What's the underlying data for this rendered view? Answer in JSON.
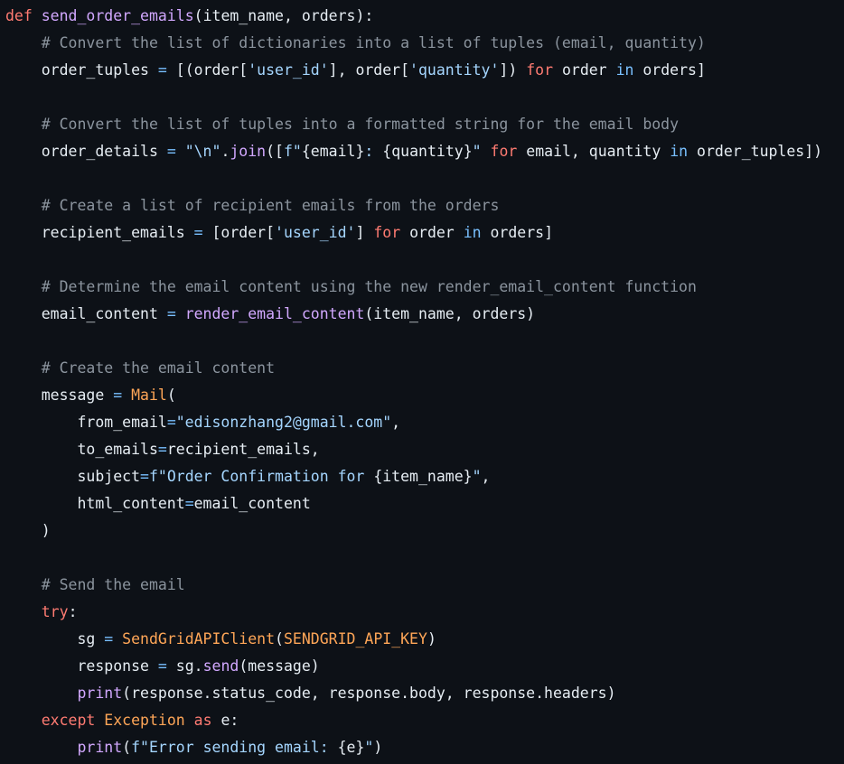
{
  "editor": {
    "theme_colors": {
      "background": "#0d1117",
      "plain": "#e6edf3",
      "keyword": "#ff7b72",
      "function": "#d2a8ff",
      "string": "#a5d6ff",
      "comment": "#8b949e",
      "builtin": "#79c0ff",
      "class": "#ffa657"
    },
    "lines": [
      [
        [
          "keyword",
          "def"
        ],
        [
          "plain",
          " "
        ],
        [
          "func",
          "send_order_emails"
        ],
        [
          "plain",
          "(item_name, orders):"
        ]
      ],
      [
        [
          "plain",
          "    "
        ],
        [
          "comment",
          "# Convert the list of dictionaries into a list of tuples (email, quantity)"
        ]
      ],
      [
        [
          "plain",
          "    order_tuples "
        ],
        [
          "op",
          "="
        ],
        [
          "plain",
          " [(order["
        ],
        [
          "string",
          "'user_id'"
        ],
        [
          "plain",
          "], order["
        ],
        [
          "string",
          "'quantity'"
        ],
        [
          "plain",
          "]) "
        ],
        [
          "keyword",
          "for"
        ],
        [
          "plain",
          " order "
        ],
        [
          "op",
          "in"
        ],
        [
          "plain",
          " orders]"
        ]
      ],
      [],
      [
        [
          "plain",
          "    "
        ],
        [
          "comment",
          "# Convert the list of tuples into a formatted string for the email body"
        ]
      ],
      [
        [
          "plain",
          "    order_details "
        ],
        [
          "op",
          "="
        ],
        [
          "plain",
          " "
        ],
        [
          "string",
          "\"\\n\""
        ],
        [
          "plain",
          "."
        ],
        [
          "func",
          "join"
        ],
        [
          "plain",
          "(["
        ],
        [
          "string",
          "f\""
        ],
        [
          "plain",
          "{email}"
        ],
        [
          "string",
          ": "
        ],
        [
          "plain",
          "{quantity}"
        ],
        [
          "string",
          "\""
        ],
        [
          "plain",
          " "
        ],
        [
          "keyword",
          "for"
        ],
        [
          "plain",
          " email, quantity "
        ],
        [
          "op",
          "in"
        ],
        [
          "plain",
          " order_tuples])"
        ]
      ],
      [],
      [
        [
          "plain",
          "    "
        ],
        [
          "comment",
          "# Create a list of recipient emails from the orders"
        ]
      ],
      [
        [
          "plain",
          "    recipient_emails "
        ],
        [
          "op",
          "="
        ],
        [
          "plain",
          " [order["
        ],
        [
          "string",
          "'user_id'"
        ],
        [
          "plain",
          "] "
        ],
        [
          "keyword",
          "for"
        ],
        [
          "plain",
          " order "
        ],
        [
          "op",
          "in"
        ],
        [
          "plain",
          " orders]"
        ]
      ],
      [],
      [
        [
          "plain",
          "    "
        ],
        [
          "comment",
          "# Determine the email content using the new render_email_content function"
        ]
      ],
      [
        [
          "plain",
          "    email_content "
        ],
        [
          "op",
          "="
        ],
        [
          "plain",
          " "
        ],
        [
          "func",
          "render_email_content"
        ],
        [
          "plain",
          "(item_name, orders)"
        ]
      ],
      [],
      [
        [
          "plain",
          "    "
        ],
        [
          "comment",
          "# Create the email content"
        ]
      ],
      [
        [
          "plain",
          "    message "
        ],
        [
          "op",
          "="
        ],
        [
          "plain",
          " "
        ],
        [
          "class",
          "Mail"
        ],
        [
          "plain",
          "("
        ]
      ],
      [
        [
          "plain",
          "        from_email"
        ],
        [
          "op",
          "="
        ],
        [
          "string",
          "\"edisonzhang2@gmail.com\""
        ],
        [
          "plain",
          ","
        ]
      ],
      [
        [
          "plain",
          "        to_emails"
        ],
        [
          "op",
          "="
        ],
        [
          "plain",
          "recipient_emails,"
        ]
      ],
      [
        [
          "plain",
          "        subject"
        ],
        [
          "op",
          "="
        ],
        [
          "string",
          "f\"Order Confirmation for "
        ],
        [
          "plain",
          "{item_name}"
        ],
        [
          "string",
          "\""
        ],
        [
          "plain",
          ","
        ]
      ],
      [
        [
          "plain",
          "        html_content"
        ],
        [
          "op",
          "="
        ],
        [
          "plain",
          "email_content"
        ]
      ],
      [
        [
          "plain",
          "    )"
        ]
      ],
      [],
      [
        [
          "plain",
          "    "
        ],
        [
          "comment",
          "# Send the email"
        ]
      ],
      [
        [
          "plain",
          "    "
        ],
        [
          "keyword",
          "try"
        ],
        [
          "plain",
          ":"
        ]
      ],
      [
        [
          "plain",
          "        sg "
        ],
        [
          "op",
          "="
        ],
        [
          "plain",
          " "
        ],
        [
          "class",
          "SendGridAPIClient"
        ],
        [
          "plain",
          "("
        ],
        [
          "class",
          "SENDGRID_API_KEY"
        ],
        [
          "plain",
          ")"
        ]
      ],
      [
        [
          "plain",
          "        response "
        ],
        [
          "op",
          "="
        ],
        [
          "plain",
          " sg."
        ],
        [
          "func",
          "send"
        ],
        [
          "plain",
          "(message)"
        ]
      ],
      [
        [
          "plain",
          "        "
        ],
        [
          "func",
          "print"
        ],
        [
          "plain",
          "(response.status_code, response.body, response.headers)"
        ]
      ],
      [
        [
          "plain",
          "    "
        ],
        [
          "keyword",
          "except"
        ],
        [
          "plain",
          " "
        ],
        [
          "class",
          "Exception"
        ],
        [
          "plain",
          " "
        ],
        [
          "keyword",
          "as"
        ],
        [
          "plain",
          " e:"
        ]
      ],
      [
        [
          "plain",
          "        "
        ],
        [
          "func",
          "print"
        ],
        [
          "plain",
          "("
        ],
        [
          "string",
          "f\"Error sending email: "
        ],
        [
          "plain",
          "{e}"
        ],
        [
          "string",
          "\""
        ],
        [
          "plain",
          ")"
        ]
      ]
    ]
  }
}
